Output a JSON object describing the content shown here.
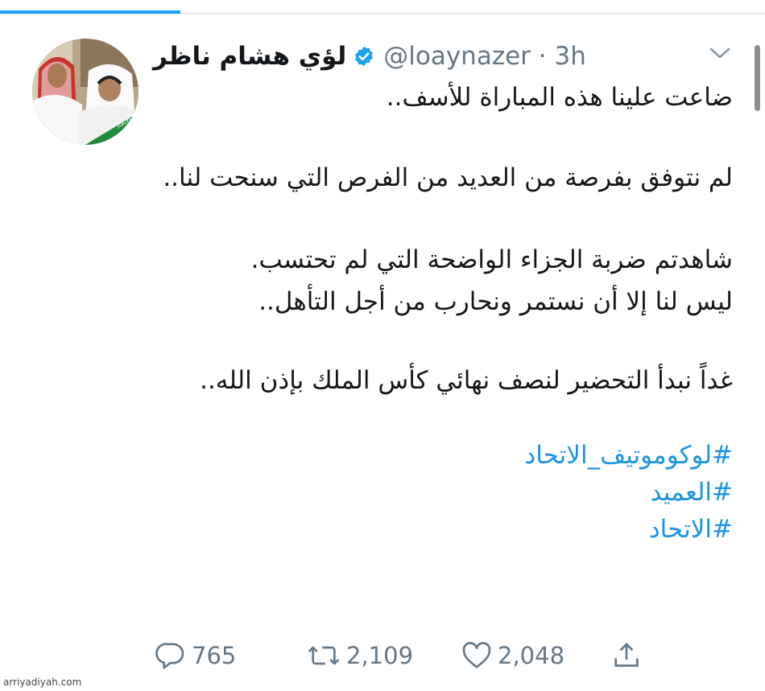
{
  "header": {
    "display_name": "لؤي هشام ناظر",
    "handle_time": "@loaynazer · 3h"
  },
  "tweet": {
    "line1": "ضاعت علينا هذه المباراة للأسف..",
    "line2": "لم نتوفق بفرصة من العديد من الفرص التي سنحت لنا..",
    "line3": "شاهدتم ضربة الجزاء الواضحة التي لم تحتسب.",
    "line4": "ليس لنا إلا أن نستمر ونحارب من أجل التأهل..",
    "line5": "غداً نبدأ التحضير لنصف نهائي كأس الملك بإذن الله..",
    "hashtags": [
      "#لوكوموتيف_الاتحاد",
      "#العميد",
      "#الاتحاد"
    ]
  },
  "actions": {
    "replies": "765",
    "retweets": "2,109",
    "likes": "2,048"
  },
  "icons": {
    "verified": "verified-badge-icon",
    "caret": "chevron-down-icon",
    "reply": "reply-icon",
    "retweet": "retweet-icon",
    "like": "heart-icon",
    "share": "share-icon"
  },
  "colors": {
    "accent": "#1da1f2",
    "hashtag": "#1b95e0",
    "muted": "#657786"
  },
  "watermark": "arriyadiyah.com"
}
